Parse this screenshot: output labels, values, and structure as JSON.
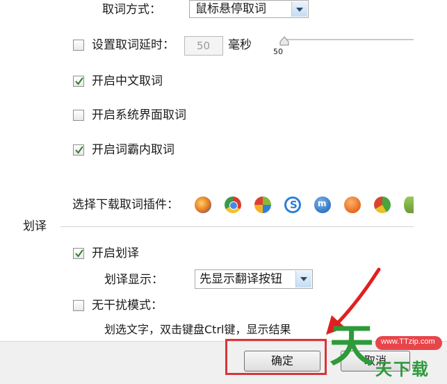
{
  "lookup": {
    "mode_label": "取词方式：",
    "mode_value": "鼠标悬停取词",
    "delay_label": "设置取词延时：",
    "delay_value": "50",
    "delay_unit": "毫秒",
    "slider_value_label": "50",
    "slider_position_fraction": 0.0,
    "chinese_label": "开启中文取词",
    "chinese_checked": true,
    "sysui_label": "开启系统界面取词",
    "sysui_checked": false,
    "inner_label": "开启词霸内取词",
    "inner_checked": true,
    "delay_checked": false,
    "plugins_label": "选择下载取词插件："
  },
  "plugins": [
    {
      "icon": "firefox-icon",
      "color": "#e3781e"
    },
    {
      "icon": "chrome-icon",
      "color": "#d93c2f"
    },
    {
      "icon": "ie-icon",
      "color": "#8ab834"
    },
    {
      "icon": "sogou-icon",
      "color": "#2e7fd3"
    },
    {
      "icon": "maxthon-icon",
      "color": "#2f76c2"
    },
    {
      "icon": "tt-icon",
      "color": "#e46a1e"
    },
    {
      "icon": "360-icon",
      "color": "#4aa33c"
    },
    {
      "icon": "plugin-icon",
      "color": "#6b9b3a"
    }
  ],
  "translate": {
    "section_title": "划译",
    "enable_label": "开启划译",
    "enable_checked": true,
    "display_label": "划译显示：",
    "display_value": "先显示翻译按钮",
    "nodisturb_label": "无干扰模式：",
    "nodisturb_checked": false,
    "hint": "划选文字，双击键盘Ctrl键，显示结果"
  },
  "footer": {
    "ok_label": "确定",
    "cancel_label": "取消"
  },
  "watermark": {
    "site": "www.TTzip.com",
    "text": "天下载",
    "big_char": "天"
  },
  "colors": {
    "highlight_box": "#d9343a",
    "annotation_arrow": "#e02020",
    "watermark_green": "#2e9a3a"
  }
}
